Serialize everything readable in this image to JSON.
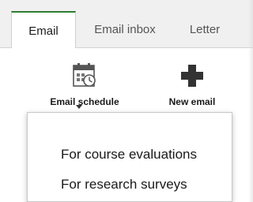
{
  "tabs": [
    {
      "label": "Email",
      "active": true
    },
    {
      "label": "Email inbox",
      "active": false
    },
    {
      "label": "Letter",
      "active": false
    }
  ],
  "ribbon": {
    "schedule_label": "Email schedule",
    "schedule_icon": "calendar-clock-icon",
    "new_email_label": "New email",
    "new_email_icon": "plus-icon",
    "plus_color": "#333333"
  },
  "dropdown": {
    "items": [
      {
        "label": "For course evaluations"
      },
      {
        "label": "For research surveys"
      }
    ]
  },
  "colors": {
    "active_tab_accent": "#2f7d32",
    "tabbar_bg": "#f0f0f0"
  }
}
